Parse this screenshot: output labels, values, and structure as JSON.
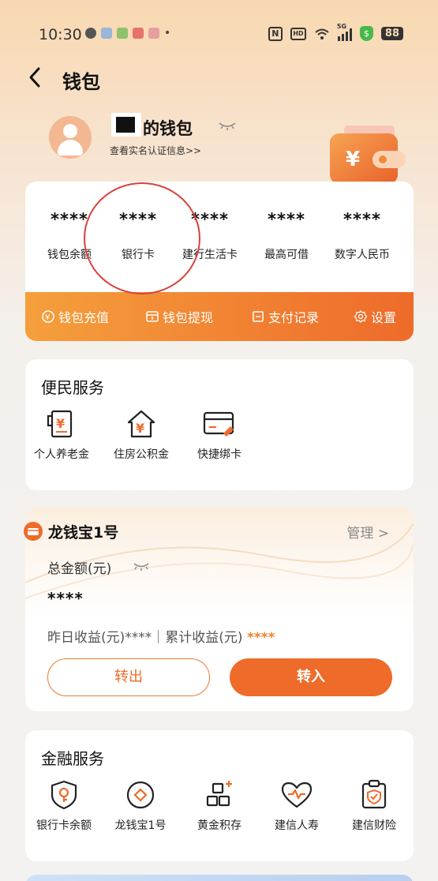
{
  "status_bar": {
    "time": "10:30",
    "network": "5G",
    "battery": "88"
  },
  "header": {
    "back_icon": "chevron-left-icon",
    "title": "钱包"
  },
  "profile": {
    "wallet_name": "的钱包",
    "verify_link": "查看实名认证信息>>"
  },
  "summary": {
    "items": [
      {
        "value": "****",
        "label": "钱包余额"
      },
      {
        "value": "****",
        "label": "银行卡"
      },
      {
        "value": "****",
        "label": "建行生活卡"
      },
      {
        "value": "****",
        "label": "最高可借"
      },
      {
        "value": "****",
        "label": "数字人民币"
      }
    ],
    "actions": [
      {
        "icon": "yuan-plus-icon",
        "label": "钱包充值"
      },
      {
        "icon": "withdraw-icon",
        "label": "钱包提现"
      },
      {
        "icon": "record-icon",
        "label": "支付记录"
      },
      {
        "icon": "gear-icon",
        "label": "设置"
      }
    ]
  },
  "convenience": {
    "title": "便民服务",
    "items": [
      {
        "icon": "pension-icon",
        "label": "个人养老金"
      },
      {
        "icon": "housing-fund-icon",
        "label": "住房公积金"
      },
      {
        "icon": "bind-card-icon",
        "label": "快捷绑卡"
      }
    ]
  },
  "longqianbao": {
    "name": "龙钱宝1号",
    "manage": "管理 >",
    "total_label": "总金额(元)",
    "total_value": "****",
    "yesterday_label": "昨日收益(元)****｜累计收益(元) ",
    "cumulative_value": "****",
    "btn_out": "转出",
    "btn_in": "转入"
  },
  "finance": {
    "title": "金融服务",
    "items": [
      {
        "icon": "card-balance-icon",
        "label": "银行卡余额"
      },
      {
        "icon": "longqianbao-icon",
        "label": "龙钱宝1号"
      },
      {
        "icon": "gold-icon",
        "label": "黄金积存"
      },
      {
        "icon": "heart-icon",
        "label": "建信人寿"
      },
      {
        "icon": "shield-icon",
        "label": "建信财险"
      }
    ]
  },
  "colors": {
    "accent": "#ee6b2a",
    "accent_light": "#f59f3c",
    "highlight_circle": "#d9423a"
  }
}
